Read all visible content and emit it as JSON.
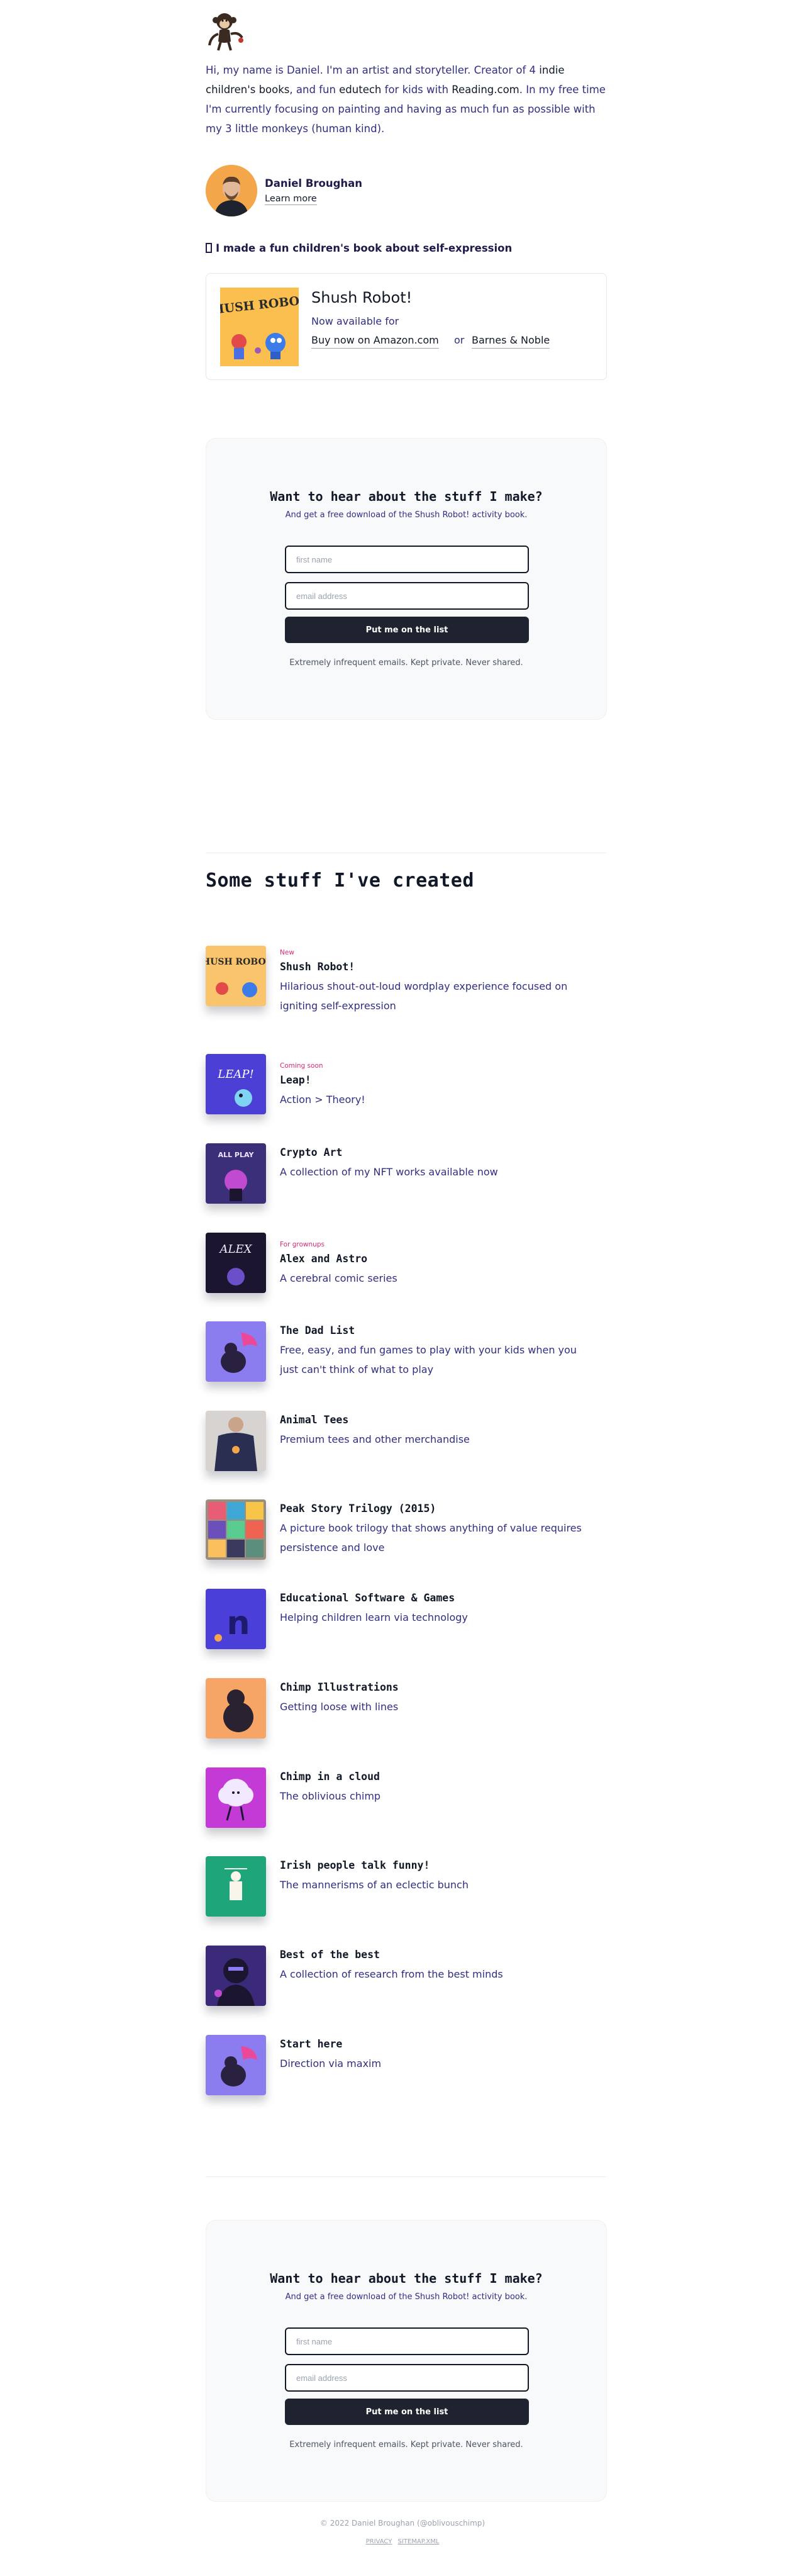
{
  "header": {
    "logo_icon": "monkey-logo-icon",
    "intro_before": "Hi, my name is Daniel. I'm an artist and storyteller. Creator of 4 ",
    "intro_link1": "indie children's books",
    "intro_mid1": ", and fun ",
    "intro_link2": "edutech",
    "intro_mid2": " for kids with ",
    "intro_link3": "Reading.com",
    "intro_after": ". In my free time I'm currently focusing on painting and having as much fun as possible with my 3 little monkeys (human kind)."
  },
  "author": {
    "name": "Daniel Broughan",
    "link": "Learn more"
  },
  "book": {
    "heading": "I made a fun children's book about self-expression",
    "cover_text": "SHUSH ROBOT!",
    "title": "Shush Robot!",
    "available": "Now available for",
    "buy_amazon": "Buy now on Amazon.com",
    "or": "or",
    "buy_bn": "Barnes & Noble"
  },
  "newsletter": {
    "title": "Want to hear about the stuff I make?",
    "subtitle": "And get a free download of the Shush Robot! activity book.",
    "first_name_placeholder": "first name",
    "email_placeholder": "email address",
    "button": "Put me on the list",
    "note": "Extremely infrequent emails. Kept private. Never shared."
  },
  "stuff": {
    "title": "Some stuff I've created",
    "items": [
      {
        "badge": "New",
        "title": "Shush Robot!",
        "desc": "Hilarious shout-out-loud wordplay experience focused on igniting self-expression",
        "bg": "#f9c46b",
        "thumb_text": "SHUSH ROBOT!"
      },
      {
        "badge": "Coming soon",
        "title": "Leap!",
        "desc": "Action > Theory!",
        "bg": "#4c3fd6",
        "thumb_text": "LEAP!"
      },
      {
        "badge": "",
        "title": "Crypto Art",
        "desc": "A collection of my NFT works available now",
        "bg": "#3b2f7a",
        "thumb_text": "ALL PLAY"
      },
      {
        "badge": "For grownups",
        "title": "Alex and Astro",
        "desc": "A cerebral comic series",
        "bg": "#1c1530",
        "thumb_text": "ALEX"
      },
      {
        "badge": "",
        "title": "The Dad List",
        "desc": "Free, easy, and fun games to play with your kids when you just can't think of what to play",
        "bg": "#8b7cf0"
      },
      {
        "badge": "",
        "title": "Animal Tees",
        "desc": "Premium tees and other merchandise",
        "bg": "#d6d3d1"
      },
      {
        "badge": "",
        "title": "Peak Story Trilogy (2015)",
        "desc": "A picture book trilogy that shows anything of value requires persistence and love",
        "bg": "#9a8f7e"
      },
      {
        "badge": "",
        "title": "Educational Software & Games",
        "desc": "Helping children learn via technology",
        "bg": "#4a3fd8",
        "thumb_text": "n"
      },
      {
        "badge": "",
        "title": "Chimp Illustrations",
        "desc": "Getting loose with lines",
        "bg": "#f7a566"
      },
      {
        "badge": "",
        "title": "Chimp in a cloud",
        "desc": "The oblivious chimp",
        "bg": "#c43ad6"
      },
      {
        "badge": "",
        "title": "Irish people talk funny!",
        "desc": "The mannerisms of an eclectic bunch",
        "bg": "#1ea57a"
      },
      {
        "badge": "",
        "title": "Best of the best",
        "desc": "A collection of research from the best minds",
        "bg": "#3b2a7a"
      },
      {
        "badge": "",
        "title": "Start here",
        "desc": "Direction via maxim",
        "bg": "#8b7cf0"
      }
    ]
  },
  "footer": {
    "copyright": "© 2022 Daniel Broughan (@oblivouschimp)",
    "link1": "PRIVACY",
    "link2": "SITEMAP.XML"
  },
  "colors": {
    "accent_badge": "#db2777",
    "button_bg": "#1f2330",
    "body_text": "#312e81"
  }
}
